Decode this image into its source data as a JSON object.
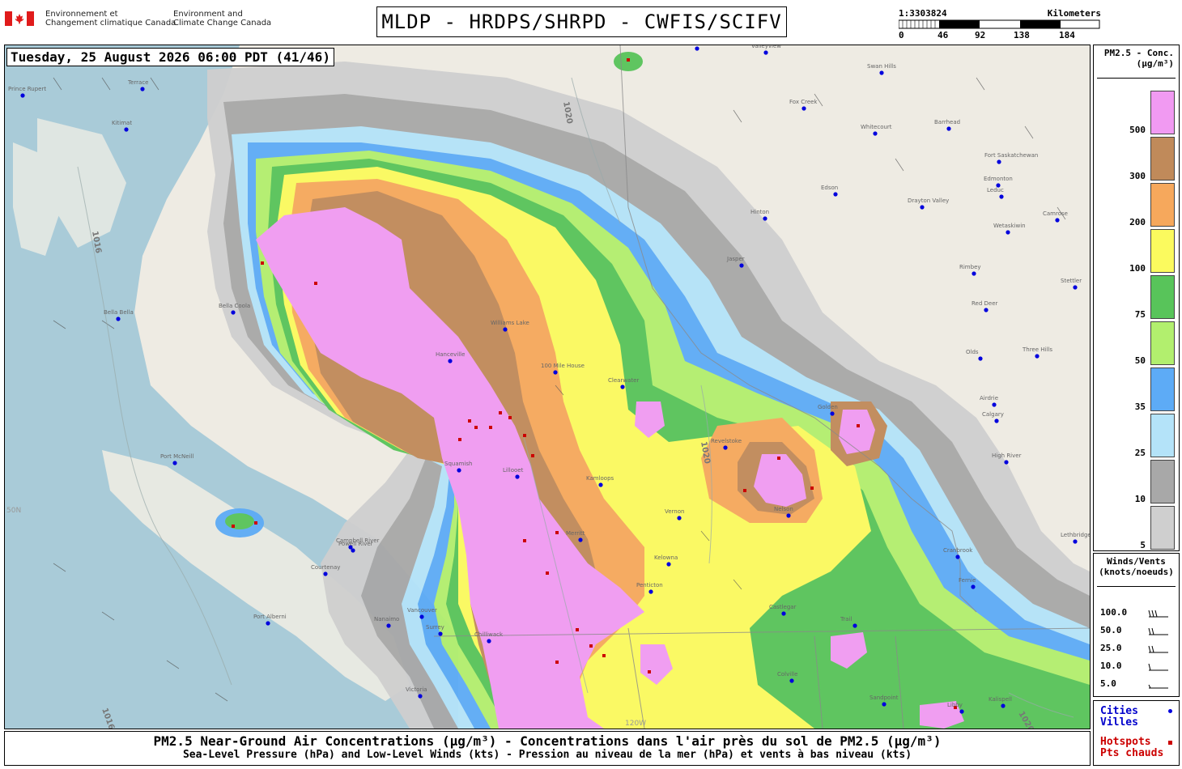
{
  "header": {
    "gov_fr": "Environnement et\nChangement climatique Canada",
    "gov_en": "Environment and\nClimate Change Canada",
    "title": "MLDP - HRDPS/SHRPD - CWFIS/SCIFV"
  },
  "scale": {
    "ratio": "1:3303824",
    "unit": "Kilometers",
    "ticks": [
      "0",
      "46",
      "92",
      "138",
      "184"
    ]
  },
  "timestamp": "Tuesday, 25 August 2026 06:00 PDT (41/46)",
  "legend": {
    "title_line1": "PM2.5 - Conc.",
    "title_line2": "(µg/m³)",
    "bins": [
      {
        "label": "500",
        "color": "#f19af2"
      },
      {
        "label": "300",
        "color": "#c08a5a"
      },
      {
        "label": "200",
        "color": "#f6a85c"
      },
      {
        "label": "100",
        "color": "#fbfa5e"
      },
      {
        "label": "75",
        "color": "#58c45a"
      },
      {
        "label": "50",
        "color": "#b2ef6e"
      },
      {
        "label": "35",
        "color": "#5dabf6"
      },
      {
        "label": "25",
        "color": "#b4e3f9"
      },
      {
        "label": "10",
        "color": "#a8a8a8"
      },
      {
        "label": "5",
        "color": "#cfcfcf"
      }
    ]
  },
  "winds": {
    "title_line1": "Winds/Vents",
    "title_line2": "(knots/noeuds)",
    "rows": [
      "100.0",
      "50.0",
      "25.0",
      "10.0",
      "5.0"
    ]
  },
  "cities_legend": {
    "cities": "Cities",
    "villes": "Villes",
    "hotspots": "Hotspots",
    "pts": "Pts chauds",
    "city_color": "#0000dd",
    "hotspot_color": "#cc0000"
  },
  "footer": {
    "line1": "PM2.5 Near-Ground Air Concentrations (µg/m³) - Concentrations dans l'air près du sol de PM2.5 (µg/m³)",
    "line2": "Sea-Level Pressure (hPa) and Low-Level Winds (kts) - Pression au niveau de la mer (hPa) et vents à bas niveau (kts)"
  },
  "map_labels": {
    "cities": [
      "Terrace",
      "Prince Rupert",
      "Kitimat",
      "Hanceville",
      "100 Mile House",
      "Williams Lake",
      "Clearwater",
      "Kamloops",
      "Revelstoke",
      "Golden",
      "Vernon",
      "Kelowna",
      "Penticton",
      "Nelson",
      "Castlegar",
      "Trail",
      "Cranbrook",
      "Fernie",
      "Vancouver",
      "Surrey",
      "Chilliwack",
      "Nanaimo",
      "Victoria",
      "Courtenay",
      "Campbell River",
      "Port Alberni",
      "Port McNeill",
      "Bella Coola",
      "Bella Bella",
      "Calgary",
      "Airdrie",
      "Red Deer",
      "Edmonton",
      "Leduc",
      "Edson",
      "Hinton",
      "Jasper",
      "Whitecourt",
      "Barrhead",
      "Fox Creek",
      "Swan Hills",
      "Valleyview",
      "Grande Prairie",
      "Olds",
      "Three Hills",
      "High River",
      "Drayton Valley",
      "Wetaskiwin",
      "Camrose",
      "Rimbey",
      "Stettler",
      "Fort Saskatchewan",
      "Merritt",
      "Lillooet",
      "Squamish",
      "Powell River",
      "Sandpoint",
      "Colville",
      "Libby",
      "Kalispell",
      "Lethbridge"
    ],
    "isobars": [
      "1016",
      "1020"
    ],
    "graticule": [
      "50N",
      "120W"
    ]
  }
}
